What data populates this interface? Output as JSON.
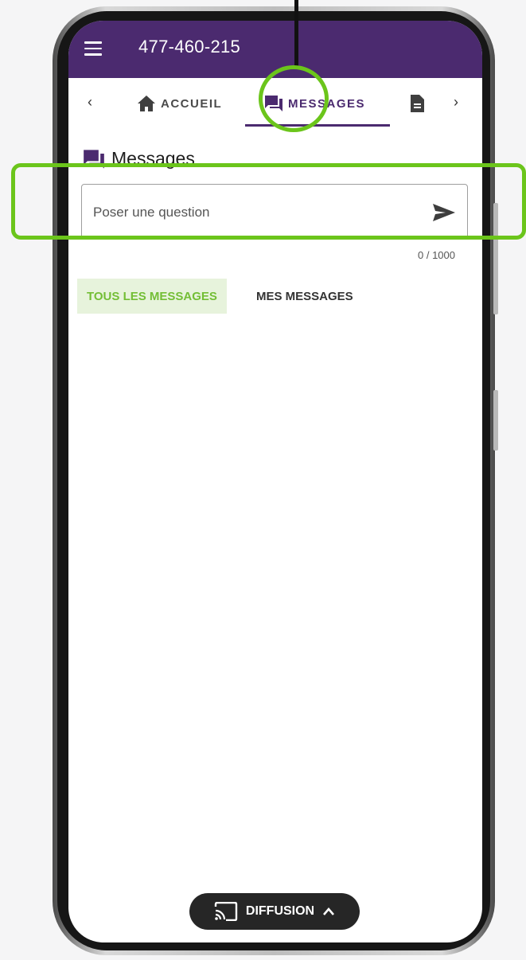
{
  "header": {
    "title": "477-460-215",
    "color": "#4b2a6f"
  },
  "tabs": [
    {
      "label": "ACCUEIL",
      "icon": "home-icon"
    },
    {
      "label": "MESSAGES",
      "icon": "messages-icon",
      "selected": true
    },
    {
      "label": "",
      "icon": "document-icon"
    }
  ],
  "section": {
    "title": "Messages",
    "icon": "messages-icon"
  },
  "question": {
    "placeholder": "Poser une question",
    "counter": "0 / 1000",
    "send_icon": "send-icon"
  },
  "filters": {
    "all_label": "TOUS LES MESSAGES",
    "mine_label": "MES MESSAGES",
    "active_color": "#73be35"
  },
  "diffusion": {
    "label": "DIFFUSION",
    "icon": "cast-icon",
    "chevron": "chevron-up-icon"
  },
  "annotation_color": "#6bc51b"
}
